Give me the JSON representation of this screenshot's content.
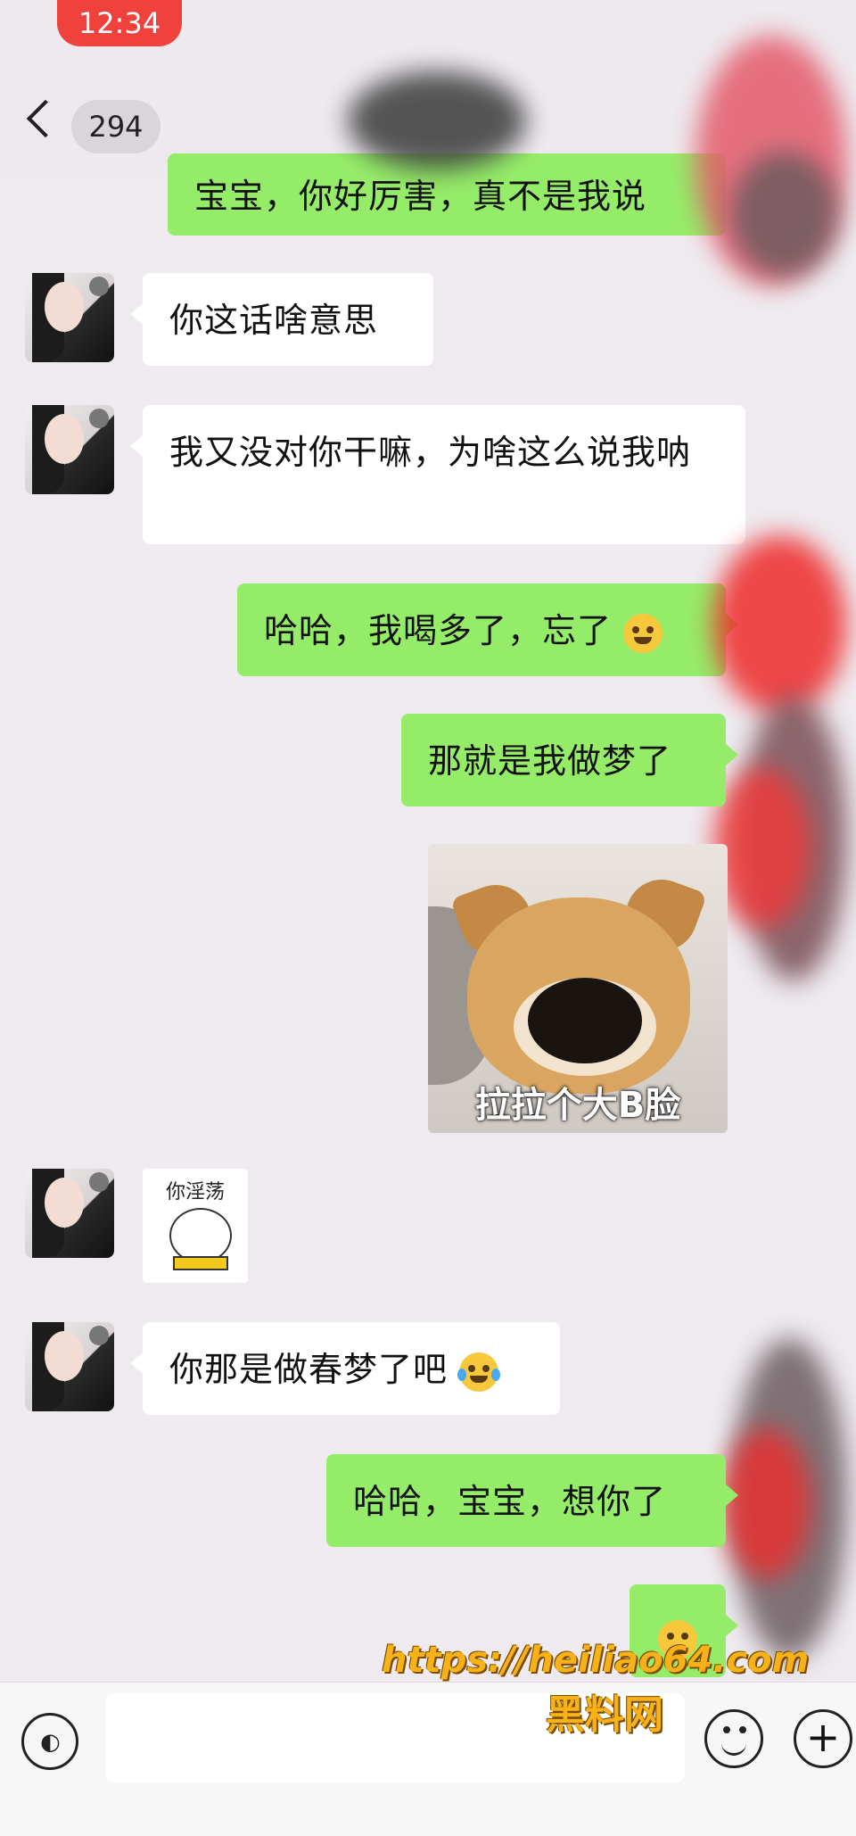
{
  "status_bar": {
    "time": "12:34"
  },
  "header": {
    "unread_count": "294"
  },
  "messages": [
    {
      "side": "out",
      "text": "宝宝，你好厉害，真不是我说"
    },
    {
      "side": "in",
      "text": "你这话啥意思"
    },
    {
      "side": "in",
      "text": "我又没对你干嘛，为啥这么说我呐"
    },
    {
      "side": "out",
      "text": "哈哈，我喝多了，忘了"
    },
    {
      "side": "out",
      "text": "那就是我做梦了"
    },
    {
      "side": "out",
      "type": "sticker",
      "caption": "拉拉个大B脸"
    },
    {
      "side": "in",
      "type": "sticker",
      "caption": "你淫荡"
    },
    {
      "side": "in",
      "text": "你那是做春梦了吧"
    },
    {
      "side": "out",
      "text": "哈哈，宝宝，想你了"
    },
    {
      "side": "out",
      "type": "emoji",
      "emoji": "sad-face"
    }
  ],
  "input_bar": {
    "voice_icon": "voice-icon",
    "emoji_icon": "emoji-icon",
    "plus_label": "+"
  },
  "watermark": {
    "url": "https://heiliao64.com",
    "name": "黑料网"
  },
  "colors": {
    "outgoing_bubble": "#95ec69",
    "incoming_bubble": "#ffffff",
    "status_pill": "#f0413d",
    "watermark": "#f6b218"
  }
}
